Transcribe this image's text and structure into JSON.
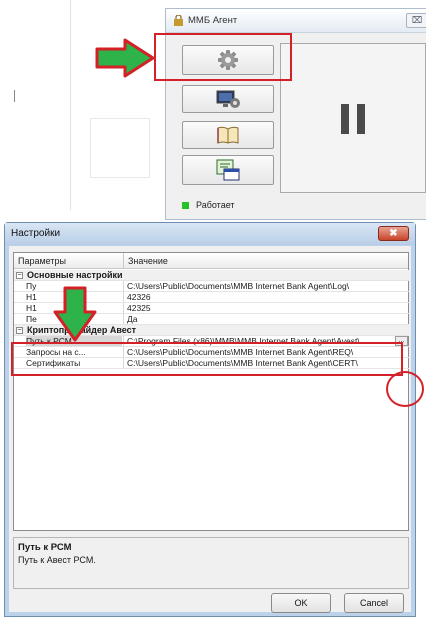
{
  "agent": {
    "title": "ММБ Агент",
    "close_glyph": "⌧",
    "status": "Работает",
    "status_color": "#26c326",
    "buttons": [
      {
        "icon": "gear-icon"
      },
      {
        "icon": "monitor-settings-icon"
      },
      {
        "icon": "book-icon"
      },
      {
        "icon": "certificate-icon"
      }
    ],
    "state_icon": "pause-icon"
  },
  "settings": {
    "title": "Настройки",
    "close_glyph": "✖",
    "columns": {
      "param": "Параметры",
      "value": "Значение"
    },
    "rows": [
      {
        "type": "category",
        "expander": "−",
        "label": "Основные настройки"
      },
      {
        "type": "property",
        "name": "Пу",
        "value": "C:\\Users\\Public\\Documents\\MMB Internet Bank Agent\\Log\\"
      },
      {
        "type": "property",
        "name": "Н1",
        "value": "42326"
      },
      {
        "type": "property",
        "name": "Н1",
        "value": "42325"
      },
      {
        "type": "property",
        "name": "Пе",
        "value": "Да"
      },
      {
        "type": "category",
        "expander": "−",
        "label": "Криптопровайдер Авест"
      },
      {
        "type": "property",
        "name": "Путь к РСМ",
        "value": "C:\\Program Files (x86)\\MMB\\MMB Internet Bank Agent\\Avest\\",
        "selected": true,
        "button": "..."
      },
      {
        "type": "property",
        "name": "Запросы на с...",
        "value": "C:\\Users\\Public\\Documents\\MMB Internet Bank Agent\\REQ\\"
      },
      {
        "type": "property",
        "name": "Сертификаты",
        "value": "C:\\Users\\Public\\Documents\\MMB Internet Bank Agent\\CERT\\"
      }
    ],
    "help": {
      "title": "Путь к РСМ",
      "text": "Путь к Авест РСМ."
    },
    "buttons": {
      "ok": "OK",
      "cancel": "Cancel"
    }
  },
  "colors": {
    "annotation_red": "#d42027",
    "arrow_green": "#2db34a"
  }
}
